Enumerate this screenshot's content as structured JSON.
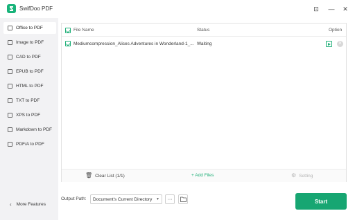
{
  "app": {
    "title": "SwifDoo PDF"
  },
  "window_controls": {
    "pin": "⊡",
    "minimize": "—",
    "close": "✕"
  },
  "sidebar": {
    "items": [
      {
        "label": "Office to PDF",
        "icon": "office-icon",
        "active": true
      },
      {
        "label": "Image to PDF",
        "icon": "image-icon",
        "active": false
      },
      {
        "label": "CAD to PDF",
        "icon": "cad-icon",
        "active": false
      },
      {
        "label": "EPUB to PDF",
        "icon": "epub-icon",
        "active": false
      },
      {
        "label": "HTML to PDF",
        "icon": "html-icon",
        "active": false
      },
      {
        "label": "TXT to PDF",
        "icon": "txt-icon",
        "active": false
      },
      {
        "label": "XPS to PDF",
        "icon": "xps-icon",
        "active": false
      },
      {
        "label": "Markdown to PDF",
        "icon": "markdown-icon",
        "active": false
      },
      {
        "label": "PDF/A to PDF",
        "icon": "pdfa-icon",
        "active": false
      }
    ],
    "more_features": "More Features"
  },
  "table": {
    "columns": {
      "file_name": "File Name",
      "status": "Status",
      "option": "Option"
    },
    "rows": [
      {
        "file_name": "Mediumcompression_Alices Adventures in Wonderland-1_...",
        "status": "Waiting",
        "checked": true
      }
    ]
  },
  "footer": {
    "clear_list": "Clear List  (1/1)",
    "add_files": "+ Add Files",
    "setting": "Setting"
  },
  "output": {
    "label": "Output Path:",
    "selected": "Document's Current Directory",
    "more": "···"
  },
  "start_button": "Start",
  "colors": {
    "accent": "#17a672",
    "sidebar_bg": "#f2f2f4"
  }
}
